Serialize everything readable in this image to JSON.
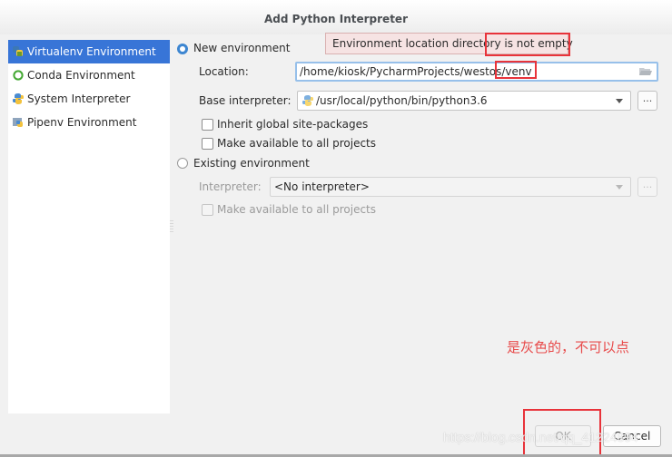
{
  "dialog": {
    "title": "Add Python Interpreter"
  },
  "sidebar": {
    "items": [
      {
        "label": "Virtualenv Environment",
        "icon": "virtualenv-icon",
        "selected": true
      },
      {
        "label": "Conda Environment",
        "icon": "conda-icon",
        "selected": false
      },
      {
        "label": "System Interpreter",
        "icon": "python-icon",
        "selected": false
      },
      {
        "label": "Pipenv Environment",
        "icon": "pipenv-icon",
        "selected": false
      }
    ]
  },
  "new_env": {
    "radio_label": "New environment",
    "selected": true,
    "location_label": "Location:",
    "location_value": "/home/kiosk/PycharmProjects/westos/venv",
    "base_label": "Base interpreter:",
    "base_value": "/usr/local/python/bin/python3.6",
    "inherit_label": "Inherit global site-packages",
    "inherit_checked": false,
    "make_available_label": "Make available to all projects",
    "make_available_checked": false
  },
  "existing_env": {
    "radio_label": "Existing environment",
    "selected": false,
    "interpreter_label": "Interpreter:",
    "interpreter_value": "<No interpreter>",
    "make_available_label": "Make available to all projects",
    "make_available_checked": false
  },
  "error_tooltip": "Environment location directory is not empty",
  "browse_label": "...",
  "annotation": "是灰色的，不可以点",
  "buttons": {
    "ok": "OK",
    "cancel": "Cancel",
    "ok_disabled": true
  },
  "watermark": "https://blog.csdn.net/qq_41224894",
  "colors": {
    "selection": "#3875d7",
    "annotation_red": "#e8333a",
    "tooltip_bg": "#f6e3e3"
  }
}
